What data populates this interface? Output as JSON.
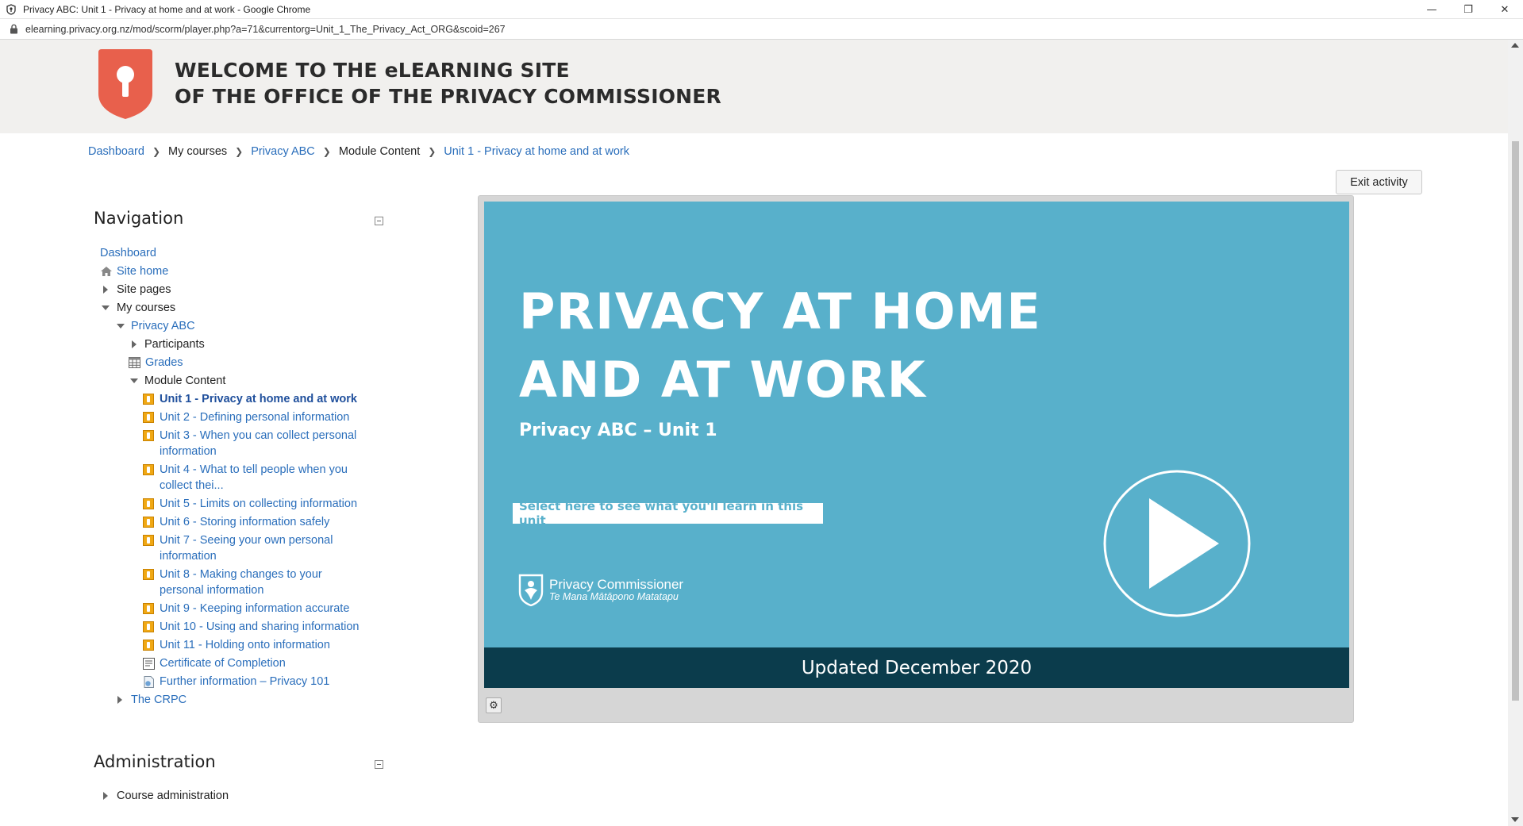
{
  "browser": {
    "window_title": "Privacy ABC: Unit 1 - Privacy at home and at work - Google Chrome",
    "url": "elearning.privacy.org.nz/mod/scorm/player.php?a=71&currentorg=Unit_1_The_Privacy_Act_ORG&scoid=267",
    "minimize": "—",
    "restore": "❐",
    "close": "✕"
  },
  "header": {
    "title_line1": "WELCOME TO THE eLEARNING SITE",
    "title_line2": "OF THE OFFICE OF THE PRIVACY COMMISSIONER",
    "logo_color": "#e8604c"
  },
  "breadcrumb": [
    {
      "label": "Dashboard",
      "link": true
    },
    {
      "label": "My courses",
      "link": false
    },
    {
      "label": "Privacy ABC",
      "link": true
    },
    {
      "label": "Module Content",
      "link": false
    },
    {
      "label": "Unit 1 - Privacy at home and at work",
      "link": true
    }
  ],
  "exit_button": "Exit activity",
  "navigation": {
    "title": "Navigation",
    "dashboard": "Dashboard",
    "site_home": "Site home",
    "site_pages": "Site pages",
    "my_courses": "My courses",
    "privacy_abc": "Privacy ABC",
    "participants": "Participants",
    "grades": "Grades",
    "module_content": "Module Content",
    "units": [
      {
        "line1": "Unit 1 - Privacy at home and at work",
        "line2": ""
      },
      {
        "line1": "Unit 2 - Defining personal information",
        "line2": ""
      },
      {
        "line1": "Unit 3 - When you can collect personal",
        "line2": "information"
      },
      {
        "line1": "Unit 4 - What to tell people when you",
        "line2": "collect thei..."
      },
      {
        "line1": "Unit 5 - Limits on collecting information",
        "line2": ""
      },
      {
        "line1": "Unit 6 - Storing information safely",
        "line2": ""
      },
      {
        "line1": "Unit 7 - Seeing your own personal",
        "line2": "information"
      },
      {
        "line1": "Unit 8 - Making changes to your",
        "line2": "personal information"
      },
      {
        "line1": "Unit 9 - Keeping information accurate",
        "line2": ""
      },
      {
        "line1": "Unit 10 - Using and sharing information",
        "line2": ""
      },
      {
        "line1": "Unit 11 - Holding onto information",
        "line2": ""
      }
    ],
    "certificate": "Certificate of Completion",
    "further_info": "Further information – Privacy 101",
    "the_crpc": "The CRPC"
  },
  "administration": {
    "title": "Administration",
    "course_admin": "Course administration"
  },
  "player": {
    "title_line1": "PRIVACY AT HOME",
    "title_line2": "AND AT WORK",
    "subtitle": "Privacy ABC – Unit 1",
    "learn_link": "Select here to see what you'll learn in this unit",
    "logo_name": "Privacy Commissioner",
    "logo_maori": "Te Mana Mātāpono Matatapu",
    "footer": "Updated December 2020",
    "bg_color": "#58b0cb",
    "footer_color": "#0b3c4c"
  }
}
